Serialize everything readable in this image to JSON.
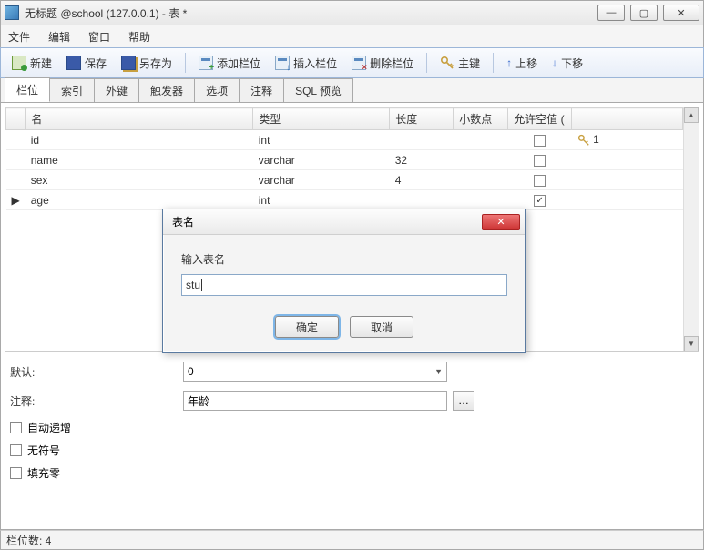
{
  "window": {
    "title": "无标题 @school (127.0.0.1) - 表 *"
  },
  "menu": {
    "file": "文件",
    "edit": "编辑",
    "window": "窗口",
    "help": "帮助"
  },
  "toolbar": {
    "new": "新建",
    "save": "保存",
    "saveas": "另存为",
    "addcol": "添加栏位",
    "inscol": "插入栏位",
    "delcol": "删除栏位",
    "pkey": "主键",
    "moveup": "上移",
    "movedown": "下移"
  },
  "tabs": {
    "fields": "栏位",
    "index": "索引",
    "fk": "外键",
    "trigger": "触发器",
    "options": "选项",
    "comment": "注释",
    "sqlpreview": "SQL 预览"
  },
  "grid": {
    "headers": {
      "name": "名",
      "type": "类型",
      "length": "长度",
      "decimal": "小数点",
      "null": "允许空值 ("
    },
    "rows": [
      {
        "name": "id",
        "type": "int",
        "length": "",
        "decimal": "",
        "nullable": false,
        "pk": "1"
      },
      {
        "name": "name",
        "type": "varchar",
        "length": "32",
        "decimal": "",
        "nullable": false,
        "pk": ""
      },
      {
        "name": "sex",
        "type": "varchar",
        "length": "4",
        "decimal": "",
        "nullable": false,
        "pk": ""
      },
      {
        "name": "age",
        "type": "int",
        "length": "",
        "decimal": "",
        "nullable": true,
        "pk": ""
      }
    ],
    "current_row_marker": "▶"
  },
  "form": {
    "default_label": "默认:",
    "default_value": "0",
    "comment_label": "注释:",
    "comment_value": "年龄",
    "auto_inc": "自动递增",
    "unsigned": "无符号",
    "zerofill": "填充零"
  },
  "status": {
    "text": "栏位数: 4"
  },
  "dialog": {
    "title": "表名",
    "label": "输入表名",
    "value": "stu",
    "ok": "确定",
    "cancel": "取消"
  }
}
